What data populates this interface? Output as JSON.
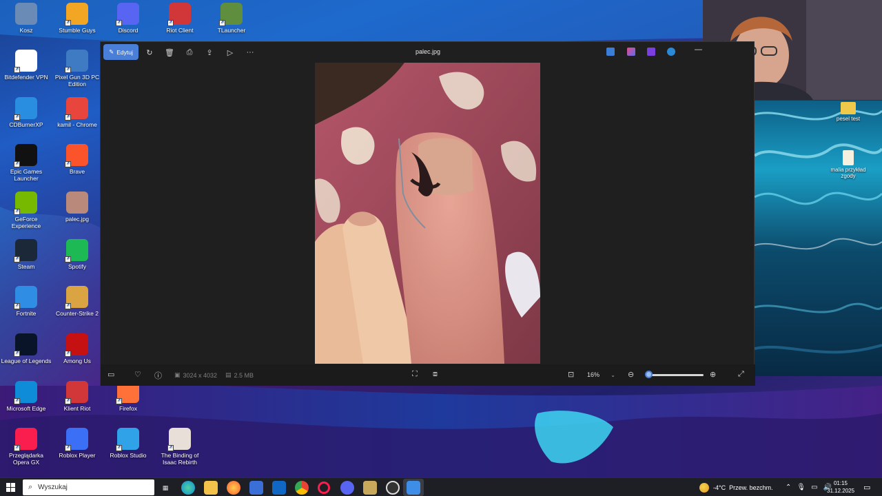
{
  "desktop": {
    "icons": [
      {
        "label": "Kosz",
        "color": "#6a8bb5"
      },
      {
        "label": "Stumble Guys",
        "color": "#f2a623"
      },
      {
        "label": "Discord",
        "color": "#5865f2"
      },
      {
        "label": "Riot Client",
        "color": "#d13639"
      },
      {
        "label": "TLauncher",
        "color": "#5e8e3e"
      },
      {
        "label": "Bitdefender VPN",
        "color": "#ffffff"
      },
      {
        "label": "Pixel Gun 3D PC Edition",
        "color": "#3f7bc2"
      },
      {
        "label": "CDBurnerXP",
        "color": "#2a8ee0"
      },
      {
        "label": "kamil - Chrome",
        "color": "#e8453c"
      },
      {
        "label": "Epic Games Launcher",
        "color": "#111111"
      },
      {
        "label": "Brave",
        "color": "#fb542b"
      },
      {
        "label": "GeForce Experience",
        "color": "#76b900"
      },
      {
        "label": "palec.jpg",
        "color": "#b98a7c"
      },
      {
        "label": "Steam",
        "color": "#1b2838"
      },
      {
        "label": "Spotify",
        "color": "#1db954"
      },
      {
        "label": "Fortnite",
        "color": "#2f8de4"
      },
      {
        "label": "Counter-Strike 2",
        "color": "#d9a441"
      },
      {
        "label": "League of Legends",
        "color": "#0a1428"
      },
      {
        "label": "Among Us",
        "color": "#c51111"
      },
      {
        "label": "Microsoft Edge",
        "color": "#0f8cd8"
      },
      {
        "label": "Klient Riot",
        "color": "#d13639"
      },
      {
        "label": "Firefox",
        "color": "#ff7139"
      },
      {
        "label": "Przeglądarka Opera GX",
        "color": "#fa1e4e"
      },
      {
        "label": "Roblox Player",
        "color": "#3b6ff5"
      },
      {
        "label": "Roblox Studio",
        "color": "#2fa2e8"
      },
      {
        "label": "The Binding of Isaac Rebirth",
        "color": "#e8e0d8"
      }
    ],
    "right_folders": [
      {
        "label": "pesel test"
      },
      {
        "label": "malia przykład zgody"
      }
    ]
  },
  "photos_app": {
    "edit_label": "Edytuj",
    "file_name": "palec.jpg",
    "dimensions": "3024 x 4032",
    "file_size": "2.5 MB",
    "zoom_value": "16%",
    "zoom_level": 0.05,
    "accent_color": "#4a7fd8"
  },
  "taskbar": {
    "search_placeholder": "Wyszukaj",
    "weather_temp": "-4°C",
    "weather_desc": "Przew. bezchm.",
    "time": "01:15",
    "date": "31.12.2025"
  }
}
